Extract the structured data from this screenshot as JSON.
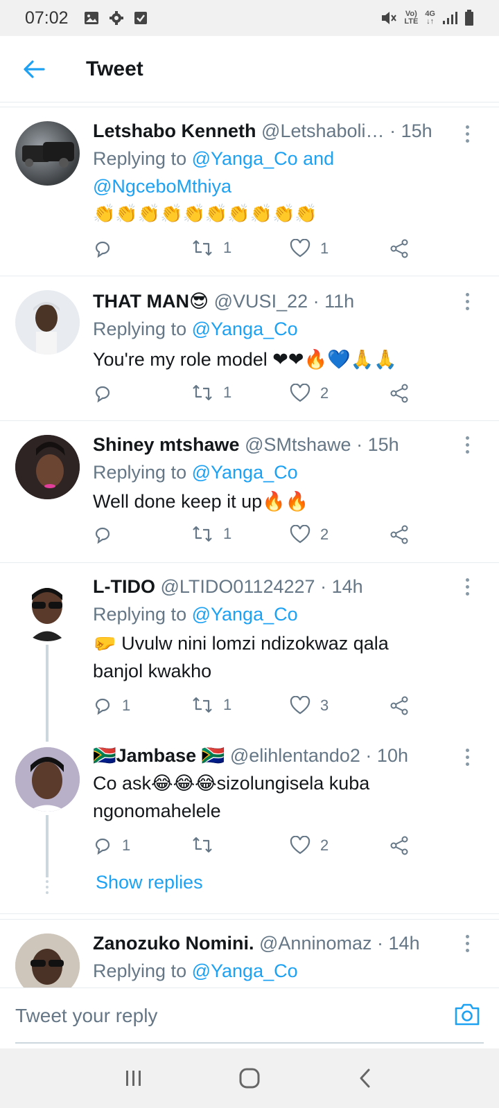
{
  "status_bar": {
    "time": "07:02",
    "volte_top": "Vo)",
    "volte_bottom": "LTE",
    "network_top": "4G",
    "network_bottom": "↓↑"
  },
  "header": {
    "title": "Tweet"
  },
  "tweets": [
    {
      "name": "Letshabo Kenneth",
      "handle": "@Letshaboli…",
      "time": "15h",
      "replying_prefix": "Replying to",
      "replying_to": "@Yanga_Co and",
      "replying_to_2": "@NgceboMthiya",
      "text": "👏👏👏👏👏👏👏👏👏👏",
      "reply_count": "",
      "retweet_count": "1",
      "like_count": "1"
    },
    {
      "name": "THAT MAN😎",
      "handle": "@VUSI_22",
      "time": "11h",
      "replying_prefix": "Replying to",
      "replying_to": "@Yanga_Co",
      "text": "You're my role model ❤❤🔥💙🙏🙏",
      "reply_count": "",
      "retweet_count": "1",
      "like_count": "2"
    },
    {
      "name": "Shiney mtshawe",
      "handle": "@SMtshawe",
      "time": "15h",
      "replying_prefix": "Replying to",
      "replying_to": "@Yanga_Co",
      "text": "Well done keep it up🔥🔥",
      "reply_count": "",
      "retweet_count": "1",
      "like_count": "2"
    },
    {
      "name": "L-TIDO",
      "handle": "@LTIDO01124227",
      "time": "14h",
      "replying_prefix": "Replying to",
      "replying_to": "@Yanga_Co",
      "text_line1": "🤛 Uvulw nini lomzi ndizokwaz qala",
      "text_line2": "banjol kwakho",
      "reply_count": "1",
      "retweet_count": "1",
      "like_count": "3"
    },
    {
      "name": "🇿🇦Jambase 🇿🇦",
      "handle": "@elihlentando2",
      "time": "10h",
      "text_line1": "Co ask😂😂😂sizolungisela kuba",
      "text_line2": "ngonomahelele",
      "reply_count": "1",
      "retweet_count": "",
      "like_count": "2",
      "show_replies": "Show replies"
    },
    {
      "name": "Zanozuko Nomini.",
      "handle": "@Anninomaz",
      "time": "14h",
      "replying_prefix": "Replying to",
      "replying_to": "@Yanga_Co"
    }
  ],
  "reply_bar": {
    "placeholder": "Tweet your reply"
  },
  "colors": {
    "accent": "#1da1f2",
    "text": "#14171a",
    "secondary": "#657786",
    "divider": "#e6ecf0"
  },
  "icons": [
    "back-arrow-icon",
    "reply-icon",
    "retweet-icon",
    "like-icon",
    "share-icon",
    "more-icon",
    "camera-icon",
    "recent-apps-icon",
    "home-icon",
    "back-nav-icon"
  ]
}
